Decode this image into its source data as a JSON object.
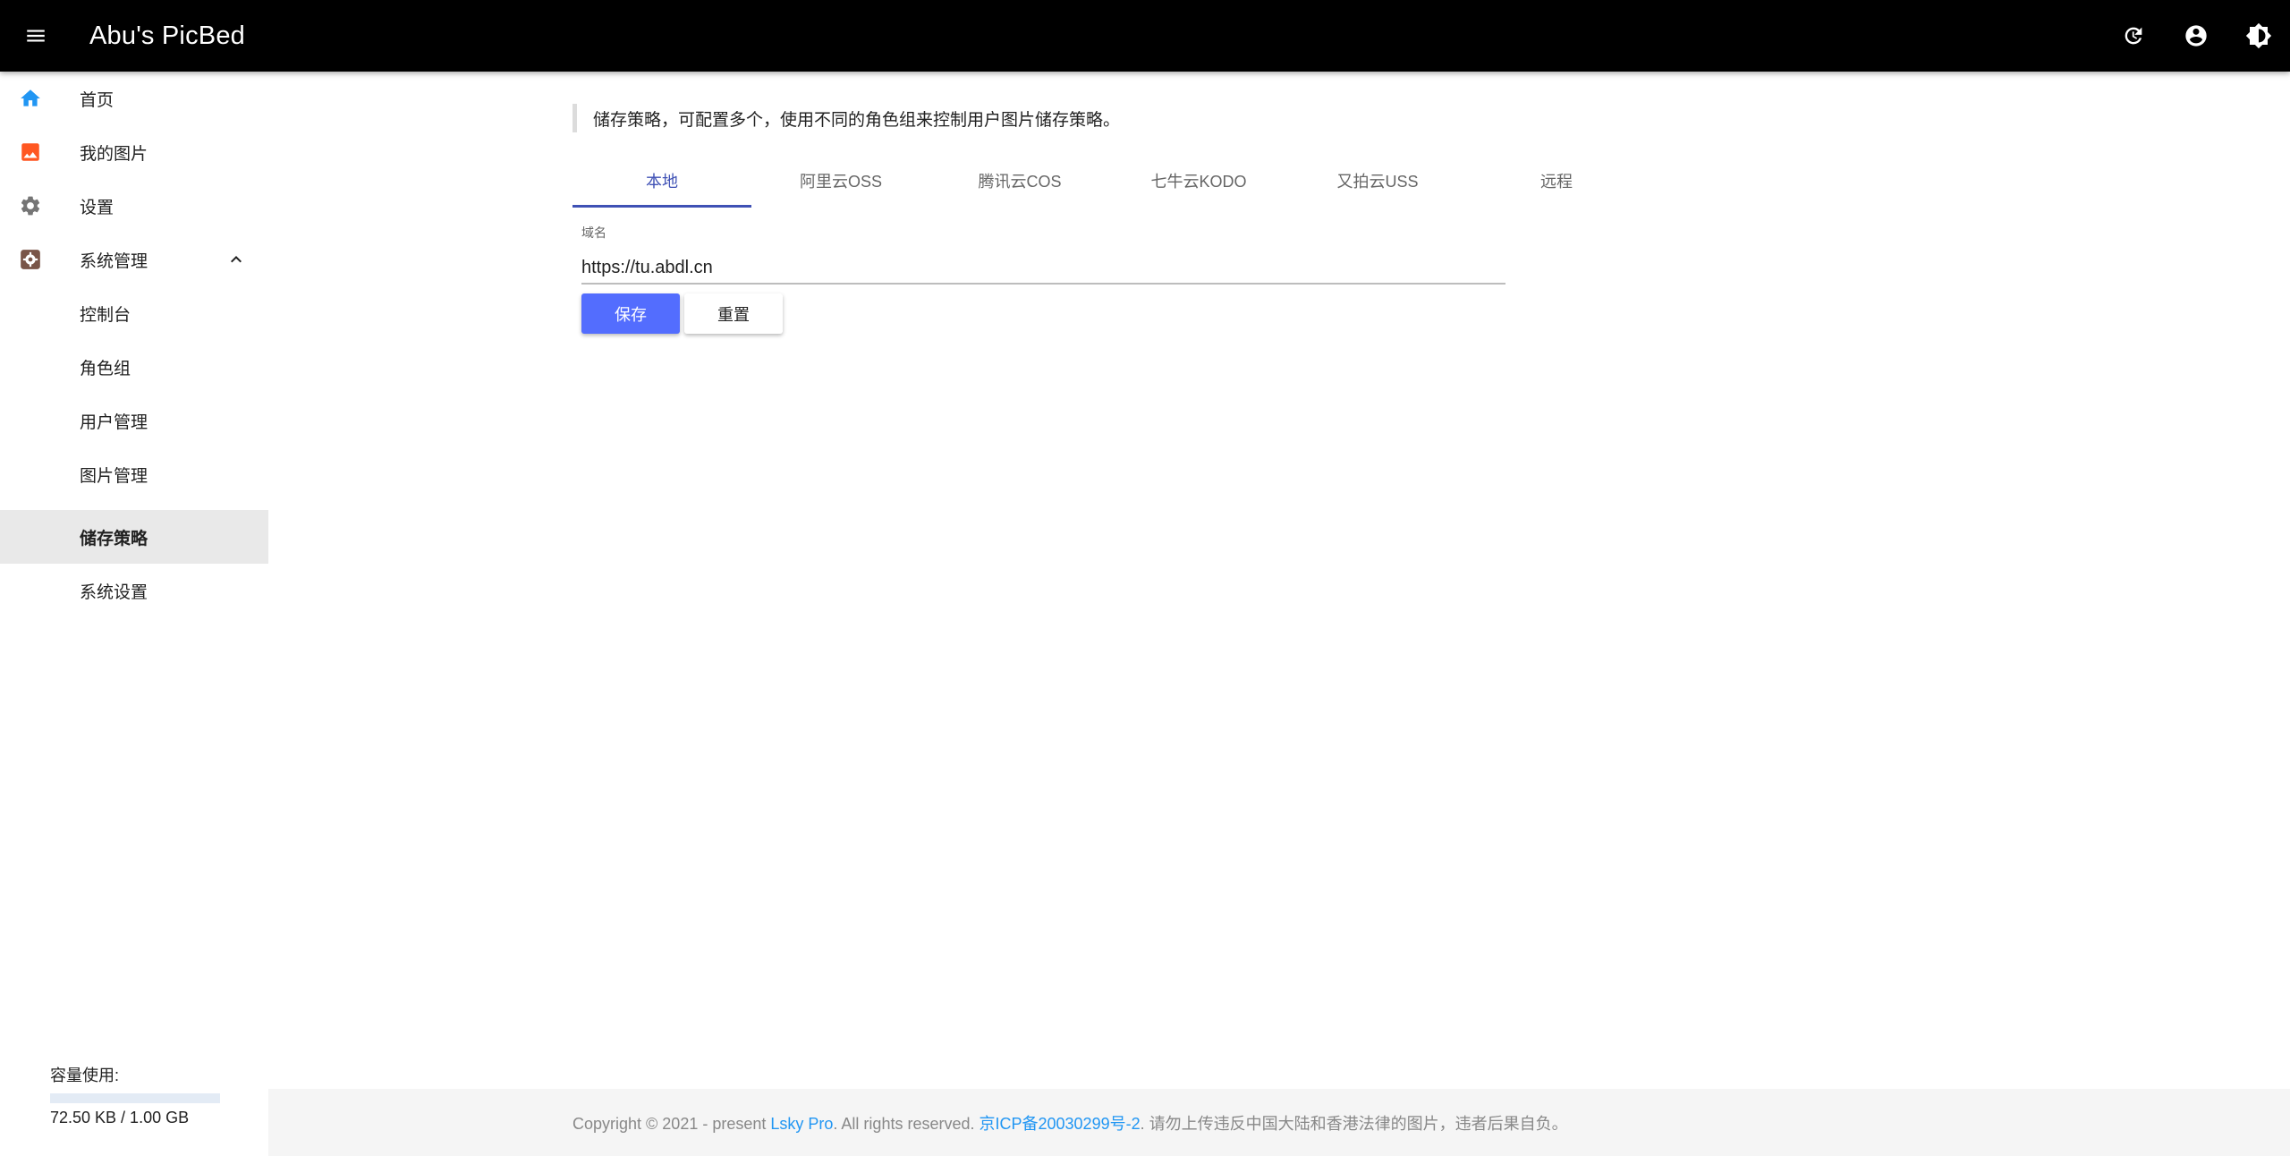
{
  "header": {
    "title": "Abu's PicBed",
    "icons": [
      "menu-icon",
      "refresh-icon",
      "account-circle-icon",
      "brightness-icon"
    ]
  },
  "sidebar": {
    "items": [
      {
        "label": "首页",
        "icon": "home-icon",
        "color": "#2196f3"
      },
      {
        "label": "我的图片",
        "icon": "image-icon",
        "color": "#ff5722"
      },
      {
        "label": "设置",
        "icon": "gear-icon",
        "color": "#757575"
      },
      {
        "label": "系统管理",
        "icon": "admin-gear-icon",
        "color": "#795548"
      }
    ],
    "sub_items": [
      {
        "label": "控制台"
      },
      {
        "label": "角色组"
      },
      {
        "label": "用户管理"
      },
      {
        "label": "图片管理"
      },
      {
        "label": "储存策略",
        "active": true
      },
      {
        "label": "系统设置"
      }
    ],
    "storage": {
      "title": "容量使用:",
      "used_fraction": 0.0001,
      "text": "72.50 KB / 1.00 GB"
    }
  },
  "main": {
    "notice": "储存策略，可配置多个，使用不同的角色组来控制用户图片储存策略。",
    "tabs": [
      {
        "label": "本地",
        "active": true
      },
      {
        "label": "阿里云OSS"
      },
      {
        "label": "腾讯云COS"
      },
      {
        "label": "七牛云KODO"
      },
      {
        "label": "又拍云USS"
      },
      {
        "label": "远程"
      }
    ],
    "domain_field": {
      "label": "域名",
      "value": "https://tu.abdl.cn"
    },
    "save_label": "保存",
    "reset_label": "重置"
  },
  "footer": {
    "copyright": "Copyright © 2021 - present ",
    "brand_link": "Lsky Pro",
    "rights": ". All rights reserved. ",
    "icp_link": "京ICP备20030299号-2",
    "warning": ". 请勿上传违反中国大陆和香港法律的图片，违者后果自负。"
  },
  "colors": {
    "topbar": "#000000",
    "accent": "#3f51b5",
    "primary_button": "#536dfe",
    "link": "#2196f3",
    "active_nav_bg": "#e9e9e9"
  }
}
